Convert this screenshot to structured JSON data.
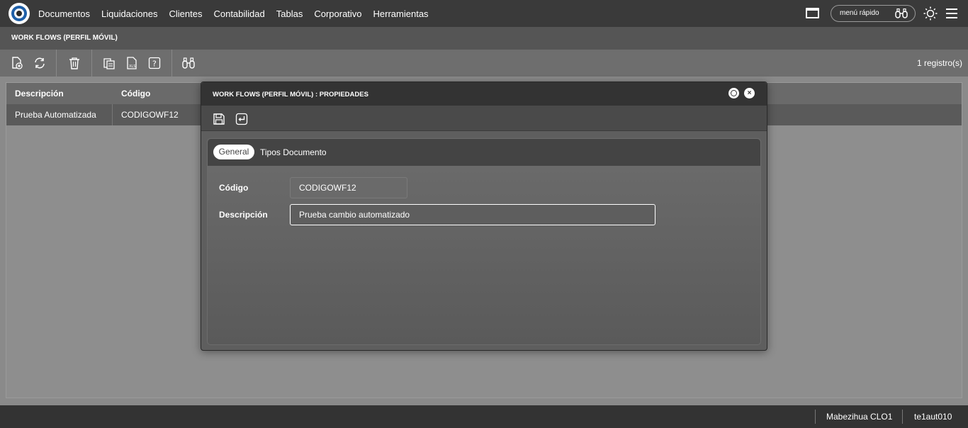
{
  "topbar": {
    "menu": [
      "Documentos",
      "Liquidaciones",
      "Clientes",
      "Contabilidad",
      "Tablas",
      "Corporativo",
      "Herramientas"
    ],
    "quick_menu": "menú rápido"
  },
  "subheader": {
    "title": "WORK FLOWS (PERFIL MÓVIL)"
  },
  "toolbar": {
    "records": "1 registro(s)"
  },
  "grid": {
    "columns": [
      "Descripción",
      "Código"
    ],
    "rows": [
      [
        "Prueba Automatizada",
        "CODIGOWF12"
      ]
    ]
  },
  "modal": {
    "title": "WORK FLOWS (PERFIL MÓVIL) : PROPIEDADES",
    "close_label": "×",
    "tabs": [
      "General",
      "Tipos Documento"
    ],
    "fields": {
      "code_label": "Código",
      "code_value": "CODIGOWF12",
      "desc_label": "Descripción",
      "desc_value": "Prueba cambio automatizado"
    }
  },
  "statusbar": {
    "user": "Mabezihua CLO1",
    "env": "te1aut010"
  },
  "colors": {
    "topbar": "#3a3a3a",
    "accent": "#1e5fa8"
  },
  "icons": [
    "app-logo-icon",
    "window-icon",
    "binoculars-icon",
    "sun-icon",
    "menu-icon",
    "new-document-icon",
    "refresh-icon",
    "delete-icon",
    "copy-icon",
    "export-xls-icon",
    "help-icon",
    "search-binoculars-icon",
    "save-icon",
    "return-icon",
    "restore-icon",
    "close-icon"
  ]
}
